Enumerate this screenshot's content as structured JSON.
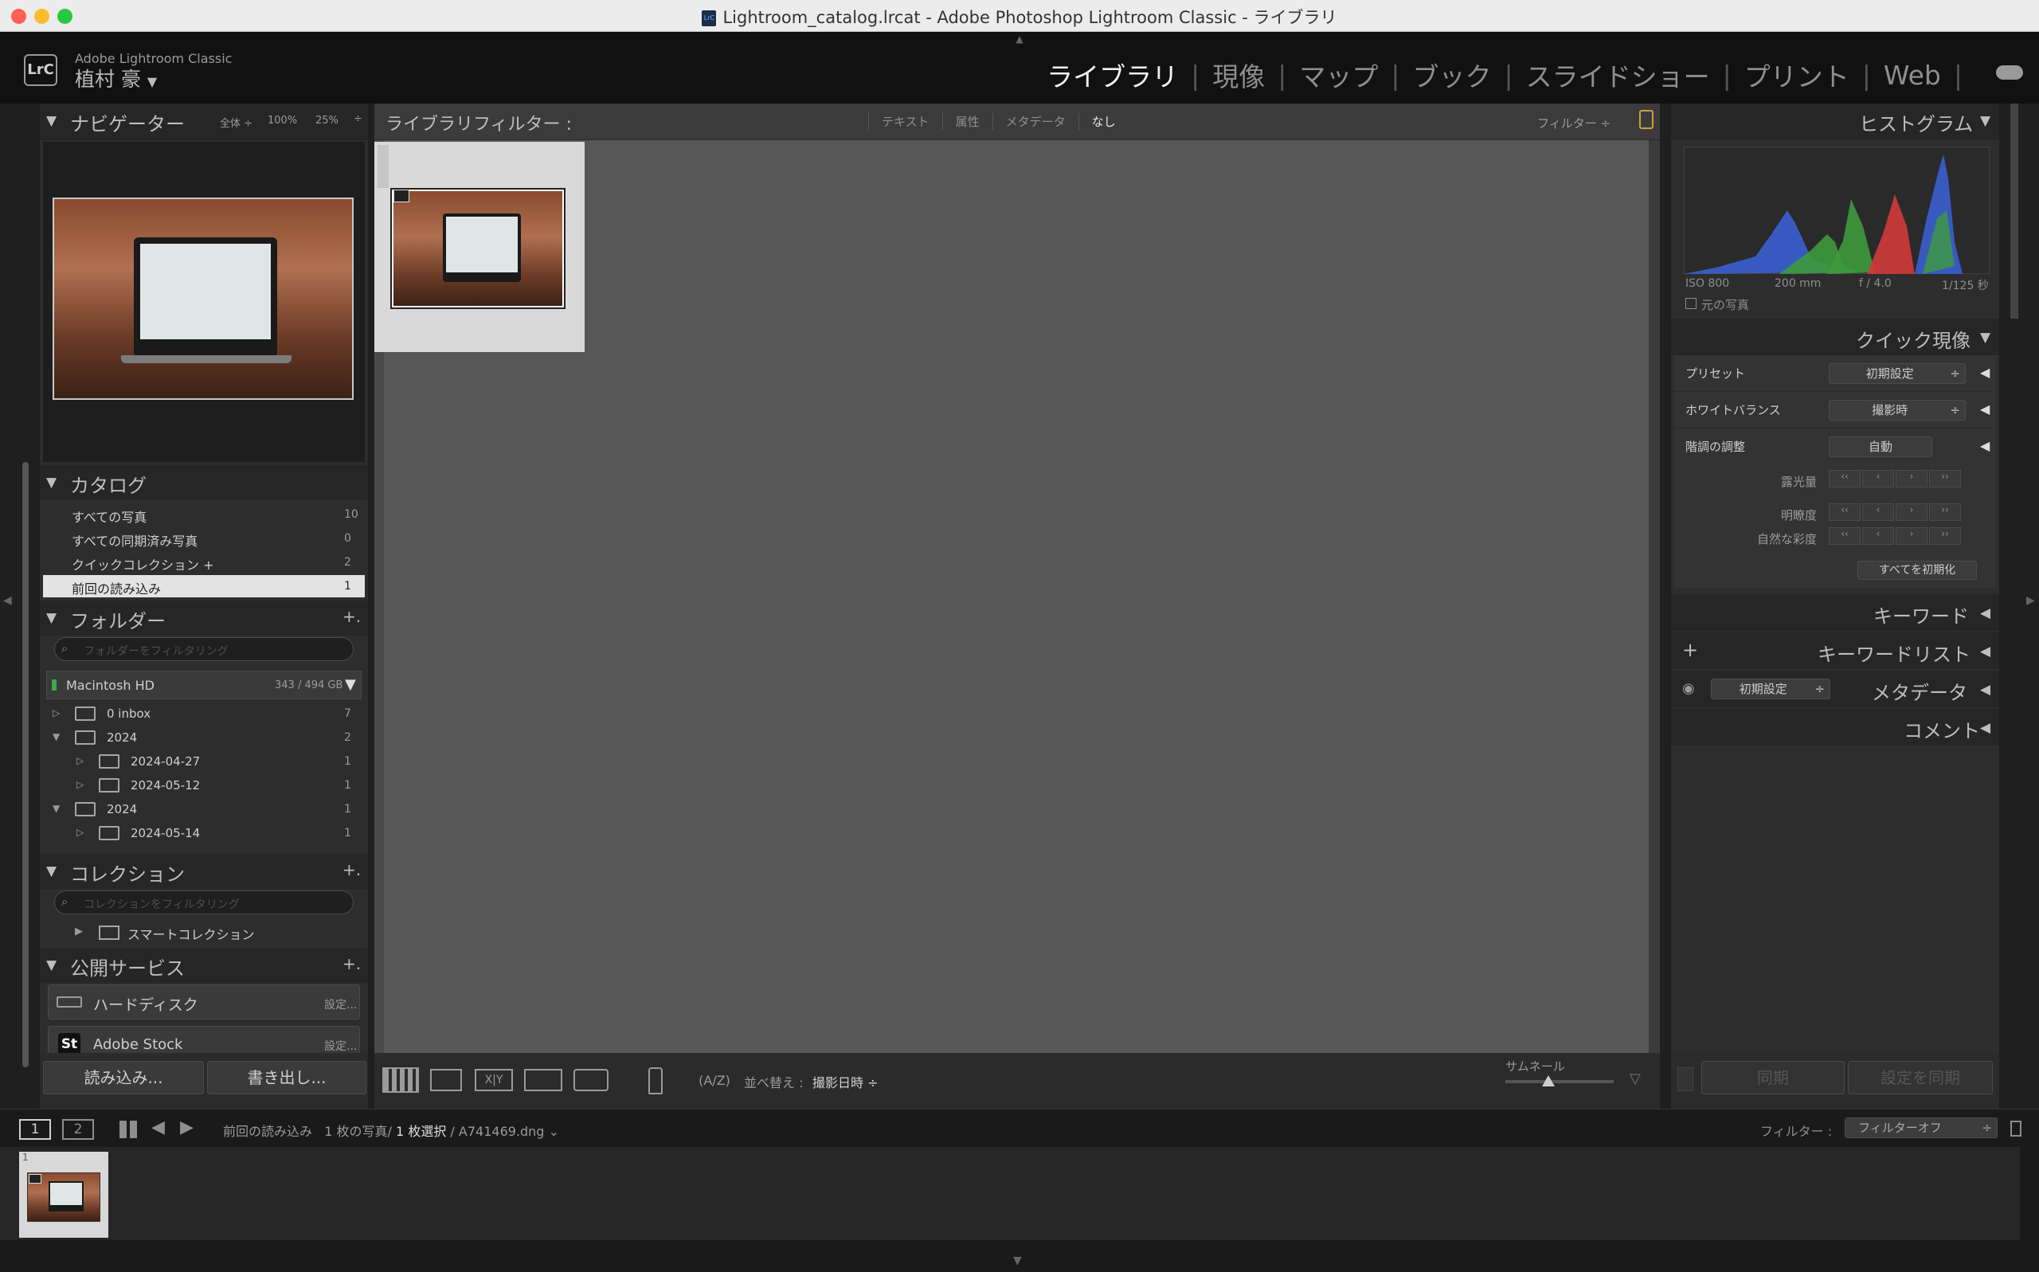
{
  "window": {
    "title": "Lightroom_catalog.lrcat - Adobe Photoshop Lightroom Classic - ライブラリ"
  },
  "identity": {
    "logo": "LrC",
    "app_name": "Adobe Lightroom Classic",
    "user_name": "植村 豪",
    "user_menu_arrow": "▼"
  },
  "modules": [
    {
      "label": "ライブラリ",
      "active": true
    },
    {
      "label": "現像",
      "active": false
    },
    {
      "label": "マップ",
      "active": false
    },
    {
      "label": "ブック",
      "active": false
    },
    {
      "label": "スライドショー",
      "active": false
    },
    {
      "label": "プリント",
      "active": false
    },
    {
      "label": "Web",
      "active": false
    }
  ],
  "navigator": {
    "title": "ナビゲーター",
    "zoom_options": [
      "全体 ÷",
      "100%",
      "25%"
    ]
  },
  "catalog": {
    "title": "カタログ",
    "items": [
      {
        "label": "すべての写真",
        "count": "10",
        "selected": false
      },
      {
        "label": "すべての同期済み写真",
        "count": "0",
        "selected": false
      },
      {
        "label": "クイックコレクション +",
        "count": "2",
        "selected": false
      },
      {
        "label": "前回の読み込み",
        "count": "1",
        "selected": true
      }
    ]
  },
  "folders": {
    "title": "フォルダー",
    "add": "+.",
    "search_placeholder": "フォルダーをフィルタリング",
    "volume": {
      "name": "Macintosh HD",
      "size": "343 / 494 GB"
    },
    "items": [
      {
        "label": "0 inbox",
        "count": "7",
        "level": 0,
        "expanded": false
      },
      {
        "label": "2024",
        "count": "2",
        "level": 0,
        "expanded": true
      },
      {
        "label": "2024-04-27",
        "count": "1",
        "level": 1,
        "expanded": false
      },
      {
        "label": "2024-05-12",
        "count": "1",
        "level": 1,
        "expanded": false
      },
      {
        "label": "2024",
        "count": "1",
        "level": 0,
        "expanded": true
      },
      {
        "label": "2024-05-14",
        "count": "1",
        "level": 1,
        "expanded": false
      }
    ]
  },
  "collections": {
    "title": "コレクション",
    "add": "+.",
    "search_placeholder": "コレクションをフィルタリング",
    "items": [
      {
        "label": "スマートコレクション"
      }
    ]
  },
  "publish": {
    "title": "公開サービス",
    "add": "+.",
    "items": [
      {
        "label": "ハードディスク",
        "action": "設定..."
      },
      {
        "label": "Adobe Stock",
        "action": "設定...",
        "badge": "St"
      }
    ]
  },
  "left_buttons": {
    "import": "読み込み...",
    "export": "書き出し..."
  },
  "filterbar": {
    "title": "ライブラリフィルター :",
    "tabs": [
      "テキスト",
      "属性",
      "メタデータ",
      "なし"
    ],
    "active_tab": "なし",
    "preset": "フィルター ÷"
  },
  "grid": {
    "selected_count": 1
  },
  "toolbar": {
    "sort_label": "並べ替え :",
    "sort_value": "撮影日時 ÷",
    "thumb_label": "サムネール",
    "thumb_size": 0.4
  },
  "histogram": {
    "title": "ヒストグラム",
    "iso": "ISO 800",
    "focal": "200 mm",
    "aperture": "f / 4.0",
    "shutter": "1/125 秒",
    "original_photo": "元の写真"
  },
  "quick_develop": {
    "title": "クイック現像",
    "preset_label": "プリセット",
    "preset_value": "初期設定",
    "wb_label": "ホワイトバランス",
    "wb_value": "撮影時",
    "tone_label": "階調の調整",
    "auto": "自動",
    "exposure": "露光量",
    "clarity": "明瞭度",
    "vibrance": "自然な彩度",
    "reset_all": "すべてを初期化",
    "step_buttons": [
      "‹‹",
      "‹",
      "›",
      "››"
    ]
  },
  "keywording": {
    "title": "キーワード"
  },
  "keyword_list": {
    "title": "キーワードリスト",
    "add": "+"
  },
  "metadata": {
    "title": "メタデータ",
    "preset": "初期設定"
  },
  "comments": {
    "title": "コメント"
  },
  "right_buttons": {
    "sync": "同期",
    "sync_settings": "設定を同期"
  },
  "filmstrip_header": {
    "screen1": "1",
    "screen2": "2",
    "source": "前回の読み込み",
    "photo_count": "1 枚の写真/",
    "selected": "1 枚選択",
    "filename": "/ A741469.dng",
    "filter_label": "フィルター :",
    "filter_value": "フィルターオフ"
  },
  "filmstrip": {
    "index": "1"
  },
  "colors": {
    "histogram_blue": "#3a5fd0",
    "histogram_green": "#3d9a3d",
    "histogram_red": "#d03a3a",
    "selected_row": "#e3e3e3"
  }
}
